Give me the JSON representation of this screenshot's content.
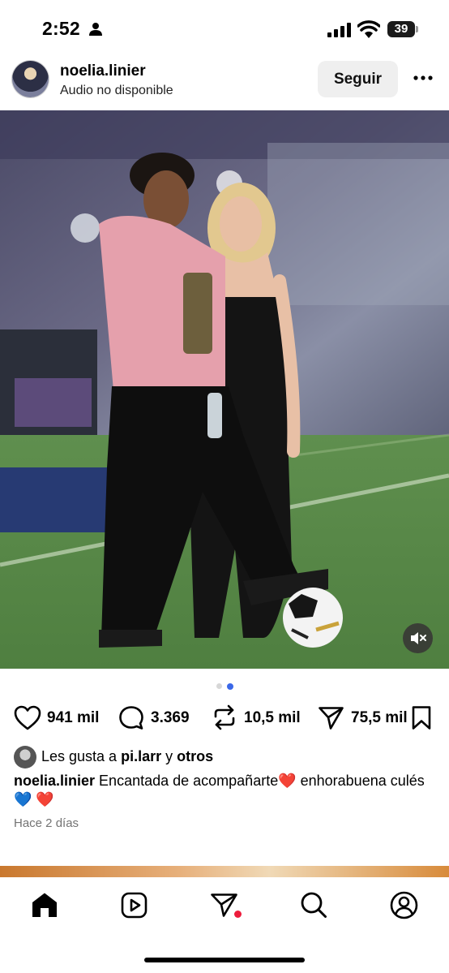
{
  "status_bar": {
    "time": "2:52",
    "battery": "39"
  },
  "post": {
    "username": "noelia.linier",
    "subtitle": "Audio no disponible",
    "follow_label": "Seguir",
    "likes_count": "941 mil",
    "comments_count": "3.369",
    "reposts_count": "10,5 mil",
    "shares_count": "75,5 mil",
    "liked_by_prefix": "Les gusta a ",
    "liked_by_user": "pi.larr",
    "liked_by_conjunction": " y ",
    "liked_by_others": "otros",
    "caption_user": "noelia.linier",
    "caption_text": "Encantada de acompañarte❤️ enhorabuena culés 💙 ❤️",
    "time_ago": "Hace 2 días",
    "carousel": {
      "count": 2,
      "active_index": 2
    }
  },
  "icons": {
    "status": [
      "person-icon",
      "signal-icon",
      "wifi-icon",
      "battery-icon"
    ],
    "actions": [
      "heart-icon",
      "comment-icon",
      "repost-icon",
      "share-icon",
      "bookmark-icon"
    ],
    "nav": [
      "home-icon",
      "reels-icon",
      "direct-icon",
      "search-icon",
      "profile-icon"
    ]
  },
  "colors": {
    "accent_dot": "#3b68e8",
    "notification_dot": "#ed1c3c",
    "follow_bg": "#efefef"
  }
}
